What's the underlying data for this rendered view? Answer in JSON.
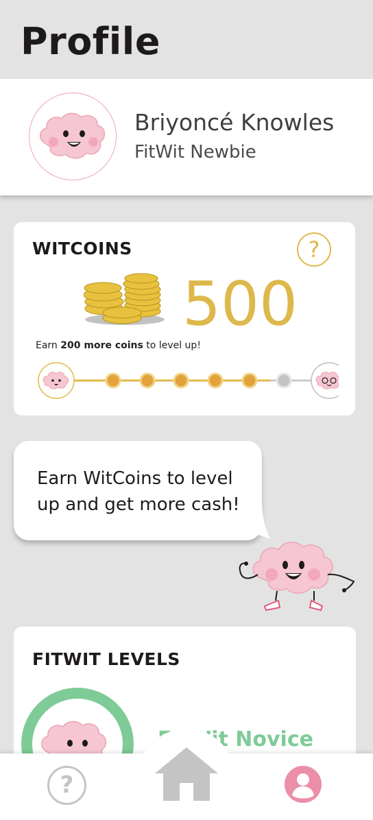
{
  "header": {
    "title": "Profile"
  },
  "profile": {
    "name": "Briyoncé Knowles",
    "rank": "FitWit Newbie"
  },
  "witcoins": {
    "heading": "WITCOINS",
    "help_glyph": "?",
    "amount": "500",
    "levelup_prefix": "Earn ",
    "levelup_bold": "200 more coins",
    "levelup_suffix": " to level up!",
    "progress": {
      "filled_steps": 5,
      "total_steps": 6
    },
    "accent_color": "#ddb84a"
  },
  "bubble": {
    "text": "Earn WitCoins to level up and get more cash!"
  },
  "levels": {
    "heading": "FITWIT LEVELS",
    "current_level": "FitWit Novice",
    "accent_color": "#7ecb97"
  },
  "nav": {
    "items": [
      {
        "icon": "help-icon",
        "glyph": "?"
      },
      {
        "icon": "home-icon"
      },
      {
        "icon": "user-icon",
        "color": "#ec8ea8"
      }
    ]
  }
}
